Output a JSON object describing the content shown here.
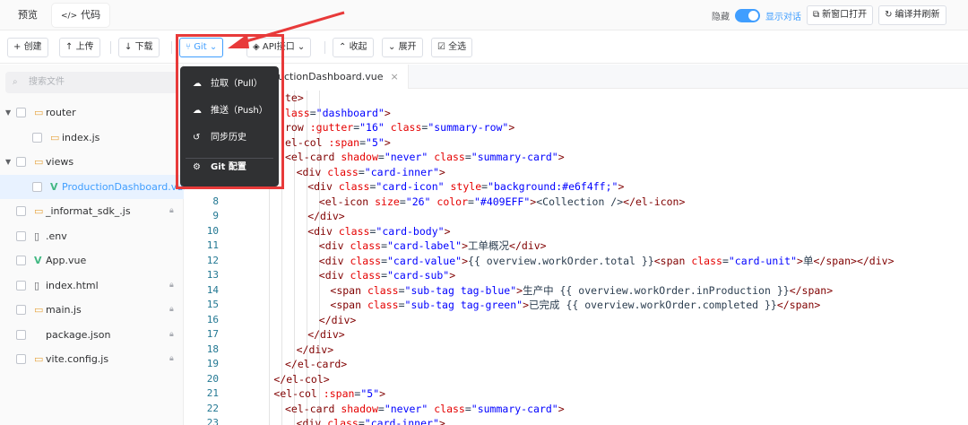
{
  "topbar": {
    "tabs": [
      {
        "label": "预览"
      },
      {
        "label": "代码",
        "icon": "</>"
      }
    ],
    "hide_label": "隐藏",
    "toggle_on": true,
    "show_dialog": "显示对话",
    "new_window": "新窗口打开",
    "compile": "编译并刷新"
  },
  "toolbar": {
    "create": "创建",
    "upload": "上传",
    "download": "下载",
    "git": "Git",
    "api": "API接口",
    "collapse": "收起",
    "expand": "展开",
    "select_all": "全选"
  },
  "sidebar": {
    "search_placeholder": "搜索文件",
    "nodes": [
      {
        "label": "router",
        "kind": "folder",
        "expanded": true
      },
      {
        "label": "index.js",
        "kind": "js"
      },
      {
        "label": "views",
        "kind": "folder",
        "expanded": true
      },
      {
        "label": "ProductionDashboard.vue",
        "kind": "vue",
        "selected": true
      },
      {
        "label": "_informat_sdk_.js",
        "kind": "js",
        "locked": true
      },
      {
        "label": ".env",
        "kind": "file"
      },
      {
        "label": "App.vue",
        "kind": "vue"
      },
      {
        "label": "index.html",
        "kind": "file",
        "locked": true
      },
      {
        "label": "main.js",
        "kind": "js",
        "locked": true
      },
      {
        "label": "package.json",
        "kind": "plain",
        "locked": true
      },
      {
        "label": "vite.config.js",
        "kind": "js",
        "locked": true
      }
    ]
  },
  "editor": {
    "tab": "uctionDashboard.vue",
    "close": "×",
    "lines": [
      {
        "n": "",
        "i": 0,
        "h": "<span class='tg'>te&gt;</span>"
      },
      {
        "n": "",
        "i": 0,
        "h": "<span class='at'>lass</span>=<span class='st'>\"dashboard\"</span><span class='tg'>&gt;</span>"
      },
      {
        "n": "",
        "i": 0,
        "h": "<span class='tg'>row</span> <span class='at'>:gutter</span>=<span class='st'>\"16\"</span> <span class='at'>class</span>=<span class='st'>\"summary-row\"</span><span class='tg'>&gt;</span>"
      },
      {
        "n": "",
        "i": 0,
        "h": "<span class='tg'>el-col</span> <span class='at'>:span</span>=<span class='st'>\"5\"</span><span class='tg'>&gt;</span>"
      },
      {
        "n": "",
        "i": 0,
        "h": "<span class='tg'>&lt;el-card</span> <span class='at'>shadow</span>=<span class='st'>\"never\"</span> <span class='at'>class</span>=<span class='st'>\"summary-card\"</span><span class='tg'>&gt;</span>"
      },
      {
        "n": "",
        "i": 1,
        "h": "<span class='tg'>&lt;div</span> <span class='at'>class</span>=<span class='st'>\"card-inner\"</span><span class='tg'>&gt;</span>"
      },
      {
        "n": "",
        "i": 2,
        "h": "<span class='tg'>&lt;div</span> <span class='at'>class</span>=<span class='st'>\"card-icon\"</span> <span class='at'>style</span>=<span class='st'>\"background:#e6f4ff;\"</span><span class='tg'>&gt;</span>"
      },
      {
        "n": "8",
        "i": 3,
        "h": "<span class='tg'>&lt;el-icon</span> <span class='at'>size</span>=<span class='st'>\"26\"</span> <span class='at'>color</span>=<span class='st'>\"#409EFF\"</span><span class='tg'>&gt;</span>&lt;Collection /&gt;<span class='tg'>&lt;/el-icon&gt;</span>"
      },
      {
        "n": "9",
        "i": 2,
        "h": "<span class='tg'>&lt;/div&gt;</span>"
      },
      {
        "n": "10",
        "i": 2,
        "h": "<span class='tg'>&lt;div</span> <span class='at'>class</span>=<span class='st'>\"card-body\"</span><span class='tg'>&gt;</span>"
      },
      {
        "n": "11",
        "i": 3,
        "h": "<span class='tg'>&lt;div</span> <span class='at'>class</span>=<span class='st'>\"card-label\"</span><span class='tg'>&gt;</span>工单概况<span class='tg'>&lt;/div&gt;</span>"
      },
      {
        "n": "12",
        "i": 3,
        "h": "<span class='tg'>&lt;div</span> <span class='at'>class</span>=<span class='st'>\"card-value\"</span><span class='tg'>&gt;</span>{{ overview.workOrder.total }}<span class='tg'>&lt;span</span> <span class='at'>class</span>=<span class='st'>\"card-unit\"</span><span class='tg'>&gt;</span>单<span class='tg'>&lt;/span&gt;&lt;/div&gt;</span>"
      },
      {
        "n": "13",
        "i": 3,
        "h": "<span class='tg'>&lt;div</span> <span class='at'>class</span>=<span class='st'>\"card-sub\"</span><span class='tg'>&gt;</span>"
      },
      {
        "n": "14",
        "i": 4,
        "h": "<span class='tg'>&lt;span</span> <span class='at'>class</span>=<span class='st'>\"sub-tag tag-blue\"</span><span class='tg'>&gt;</span>生产中 {{ overview.workOrder.inProduction }}<span class='tg'>&lt;/span&gt;</span>"
      },
      {
        "n": "15",
        "i": 4,
        "h": "<span class='tg'>&lt;span</span> <span class='at'>class</span>=<span class='st'>\"sub-tag tag-green\"</span><span class='tg'>&gt;</span>已完成 {{ overview.workOrder.completed }}<span class='tg'>&lt;/span&gt;</span>"
      },
      {
        "n": "16",
        "i": 3,
        "h": "<span class='tg'>&lt;/div&gt;</span>"
      },
      {
        "n": "17",
        "i": 2,
        "h": "<span class='tg'>&lt;/div&gt;</span>"
      },
      {
        "n": "18",
        "i": 1,
        "h": "<span class='tg'>&lt;/div&gt;</span>"
      },
      {
        "n": "19",
        "i": 0,
        "h": "<span class='tg'>&lt;/el-card&gt;</span>"
      },
      {
        "n": "20",
        "i": -1,
        "h": "<span class='tg'>&lt;/el-col&gt;</span>"
      },
      {
        "n": "21",
        "i": -1,
        "h": "<span class='tg'>&lt;el-col</span> <span class='at'>:span</span>=<span class='st'>\"5\"</span><span class='tg'>&gt;</span>"
      },
      {
        "n": "22",
        "i": 0,
        "h": "<span class='tg'>&lt;el-card</span> <span class='at'>shadow</span>=<span class='st'>\"never\"</span> <span class='at'>class</span>=<span class='st'>\"summary-card\"</span><span class='tg'>&gt;</span>"
      },
      {
        "n": "23",
        "i": 1,
        "h": "<span class='tg'>&lt;div</span> <span class='at'>class</span>=<span class='st'>\"card-inner\"</span><span class='tg'>&gt;</span>"
      }
    ]
  },
  "git_menu": {
    "items": [
      {
        "label": "拉取（Pull）",
        "icon": "cloud-download"
      },
      {
        "label": "推送（Push）",
        "icon": "cloud-upload"
      },
      {
        "label": "同步历史",
        "icon": "history"
      },
      {
        "label": "Git 配置",
        "icon": "settings"
      }
    ]
  },
  "colors": {
    "accent": "#409eff",
    "tag": "#800000",
    "attr": "#e50000",
    "string": "#0000ff",
    "highlight": "#e83a3a"
  }
}
